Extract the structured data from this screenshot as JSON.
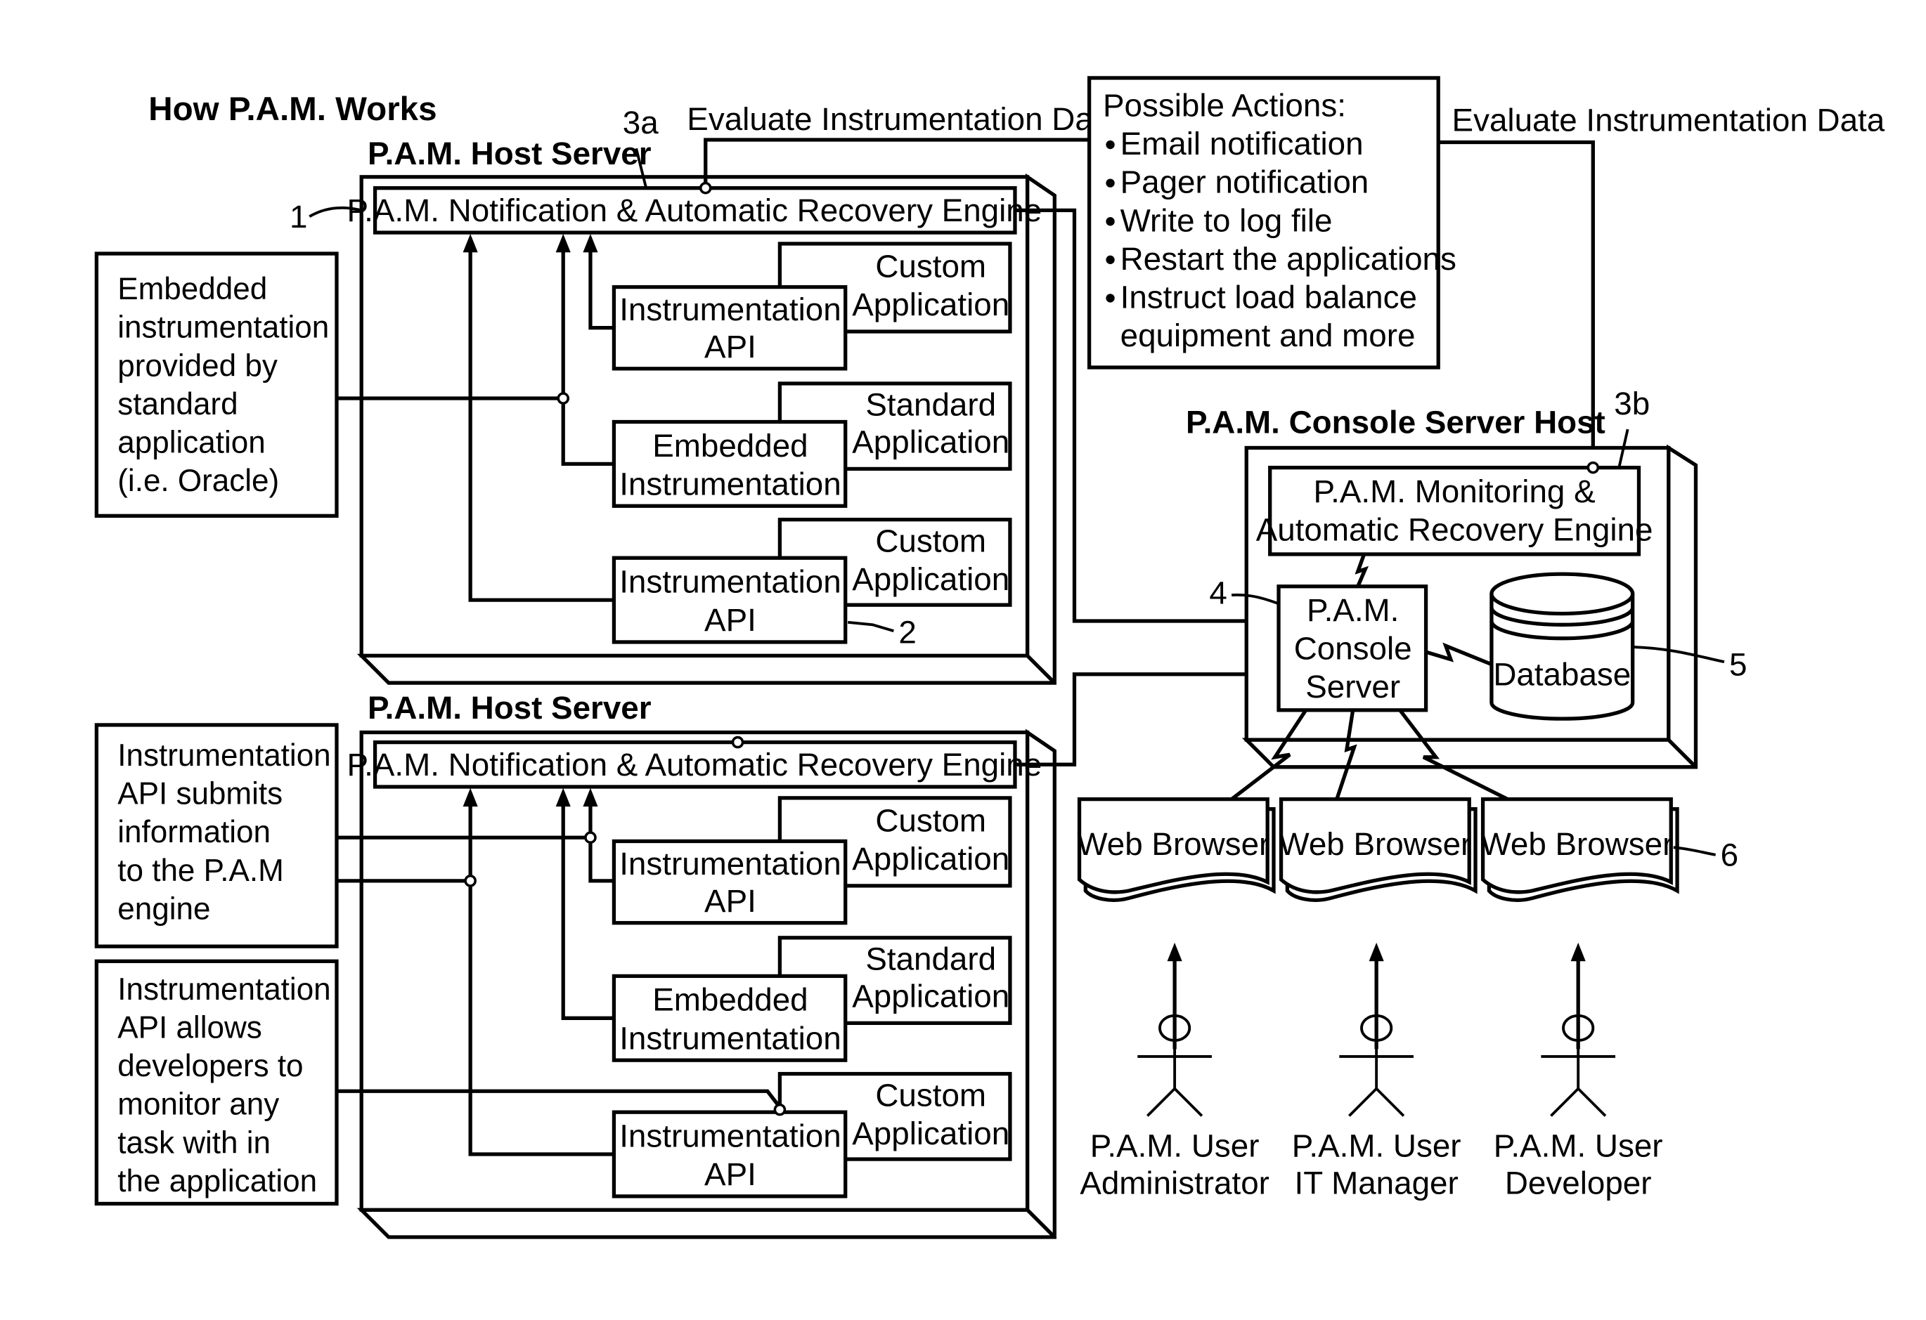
{
  "title": "How P.A.M. Works",
  "colors": {
    "ink": "#000000",
    "paper": "#ffffff"
  },
  "host_servers": [
    {
      "label": "P.A.M. Host Server",
      "ref": "1",
      "engine": {
        "label": "P.A.M. Notification & Automatic Recovery Engine",
        "ref": "3a"
      },
      "rows": [
        {
          "instr": [
            "Instrumentation",
            "API"
          ],
          "app": [
            "Custom",
            "Application"
          ]
        },
        {
          "instr": [
            "Embedded",
            "Instrumentation"
          ],
          "app": [
            "Standard",
            "Application"
          ]
        },
        {
          "instr": [
            "Instrumentation",
            "API"
          ],
          "app": [
            "Custom",
            "Application"
          ],
          "ref": "2"
        }
      ]
    },
    {
      "label": "P.A.M. Host Server",
      "engine": {
        "label": "P.A.M. Notification & Automatic Recovery Engine"
      },
      "rows": [
        {
          "instr": [
            "Instrumentation",
            "API"
          ],
          "app": [
            "Custom",
            "Application"
          ]
        },
        {
          "instr": [
            "Embedded",
            "Instrumentation"
          ],
          "app": [
            "Standard",
            "Application"
          ]
        },
        {
          "instr": [
            "Instrumentation",
            "API"
          ],
          "app": [
            "Custom",
            "Application"
          ]
        }
      ]
    }
  ],
  "notes": [
    {
      "lines": [
        "Embedded",
        "instrumentation",
        "provided by",
        "standard",
        "application",
        "(i.e. Oracle)"
      ]
    },
    {
      "lines": [
        "Instrumentation",
        "API submits",
        "information",
        "to the P.A.M",
        "engine"
      ]
    },
    {
      "lines": [
        "Instrumentation",
        "API allows",
        "developers to",
        "monitor any",
        "task with in",
        "the application"
      ]
    }
  ],
  "flow_labels": {
    "evaluate_left": "Evaluate Instrumentation Data",
    "evaluate_right": "Evaluate Instrumentation Data"
  },
  "possible_actions": {
    "heading": "Possible Actions:",
    "items": [
      "Email notification",
      "Pager notification",
      "Write to log file",
      "Restart the applications",
      "Instruct load balance",
      "equipment and more"
    ],
    "bullets": [
      true,
      true,
      true,
      true,
      true,
      false
    ]
  },
  "console_host": {
    "label": "P.A.M. Console Server Host",
    "monitor_engine": {
      "lines": [
        "P.A.M. Monitoring &",
        "Automatic Recovery Engine"
      ],
      "ref": "3b"
    },
    "console_server": {
      "lines": [
        "P.A.M.",
        "Console",
        "Server"
      ],
      "ref": "4"
    },
    "database": {
      "label": "Database",
      "ref": "5"
    }
  },
  "browsers": {
    "label": "Web Browser",
    "ref": "6",
    "items": [
      "Web Browser",
      "Web Browser",
      "Web Browser"
    ]
  },
  "users": [
    {
      "line1": "P.A.M. User",
      "line2": "Administrator"
    },
    {
      "line1": "P.A.M. User",
      "line2": "IT Manager"
    },
    {
      "line1": "P.A.M. User",
      "line2": "Developer"
    }
  ]
}
